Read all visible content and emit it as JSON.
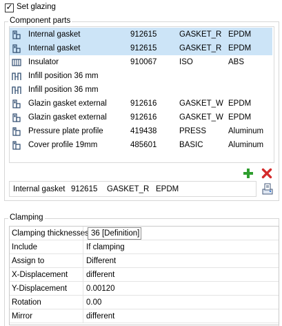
{
  "set_glazing": {
    "label": "Set glazing",
    "checked": true
  },
  "component_parts": {
    "legend": "Component parts",
    "rows": [
      {
        "icon": "gasket-icon",
        "name": "Internal gasket",
        "number": "912615",
        "code": "GASKET_R",
        "material": "EPDM",
        "selected": true
      },
      {
        "icon": "gasket-icon",
        "name": "Internal gasket",
        "number": "912615",
        "code": "GASKET_R",
        "material": "EPDM",
        "selected": true
      },
      {
        "icon": "insulator-icon",
        "name": "Insulator",
        "number": "910067",
        "code": "ISO",
        "material": "ABS",
        "selected": false
      },
      {
        "icon": "infill-icon",
        "name": "Infill position 36 mm",
        "number": "",
        "code": "",
        "material": "",
        "selected": false
      },
      {
        "icon": "infill-icon",
        "name": "Infill position 36 mm",
        "number": "",
        "code": "",
        "material": "",
        "selected": false
      },
      {
        "icon": "gasket-icon",
        "name": "Glazin gasket external",
        "number": "912616",
        "code": "GASKET_W",
        "material": "EPDM",
        "selected": false
      },
      {
        "icon": "gasket-icon",
        "name": "Glazin gasket external",
        "number": "912616",
        "code": "GASKET_W",
        "material": "EPDM",
        "selected": false
      },
      {
        "icon": "profile-icon",
        "name": "Pressure plate profile",
        "number": "419438",
        "code": "PRESS",
        "material": "Aluminum",
        "selected": false
      },
      {
        "icon": "profile-icon",
        "name": "Cover profile 19mm",
        "number": "485601",
        "code": "BASIC",
        "material": "Aluminum",
        "selected": false
      }
    ],
    "summary": {
      "name": "Internal gasket",
      "number": "912615",
      "code": "GASKET_R",
      "material": "EPDM"
    }
  },
  "clamping": {
    "legend": "Clamping",
    "rows": [
      {
        "key": "Clamping thicknesses",
        "value": "36 [Definition]",
        "editing": true
      },
      {
        "key": "Include",
        "value": "If clamping",
        "editing": false
      },
      {
        "key": "Assign to",
        "value": "Different",
        "editing": false
      },
      {
        "key": "X-Displacement",
        "value": "different",
        "editing": false
      },
      {
        "key": "Y-Displacement",
        "value": "0.00120",
        "editing": false
      },
      {
        "key": "Rotation",
        "value": "0.00",
        "editing": false
      },
      {
        "key": "Mirror",
        "value": "different",
        "editing": false
      }
    ]
  },
  "colors": {
    "selection": "#cce4f7",
    "add": "#2e9e2e",
    "delete": "#d42b2b",
    "border": "#d6d6d6"
  }
}
